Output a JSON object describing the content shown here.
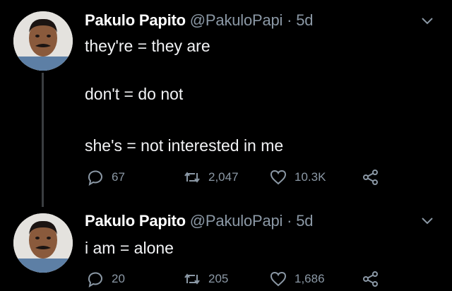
{
  "tweets": [
    {
      "name": "Pakulo Papito",
      "handle": "@PakuloPapi",
      "separator": "·",
      "time": "5d",
      "lines": [
        "they're = they are",
        "don't = do not",
        "she's = not interested in me"
      ],
      "replies": "67",
      "retweets": "2,047",
      "likes": "10.3K"
    },
    {
      "name": "Pakulo Papito",
      "handle": "@PakuloPapi",
      "separator": "·",
      "time": "5d",
      "lines": [
        "i am = alone"
      ],
      "replies": "20",
      "retweets": "205",
      "likes": "1,686"
    }
  ],
  "icons": {
    "reply": "reply-icon",
    "retweet": "retweet-icon",
    "like": "heart-icon",
    "share": "share-icon",
    "menu": "chevron-down-icon"
  },
  "colors": {
    "background": "#000000",
    "text": "#e7e9ea",
    "muted": "#8b98a5"
  }
}
